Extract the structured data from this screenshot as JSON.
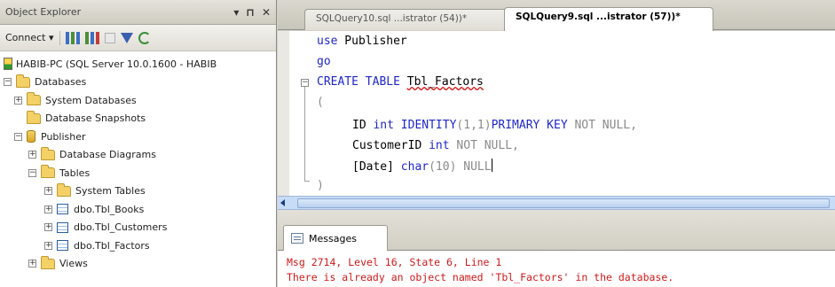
{
  "object_explorer": {
    "title": "Object Explorer",
    "title_controls": [
      "▾",
      "⊓",
      "✕"
    ],
    "connect_label": "Connect ▾",
    "tree": [
      {
        "level": 0,
        "toggle": "",
        "icon": "server-icon",
        "label": "HABIB-PC (SQL Server 10.0.1600 - HABIB"
      },
      {
        "level": 0,
        "toggle": "−",
        "icon": "folder-icon",
        "label": "Databases"
      },
      {
        "level": 1,
        "toggle": "+",
        "icon": "folder-icon",
        "label": "System Databases"
      },
      {
        "level": 1,
        "toggle": "",
        "icon": "folder-icon",
        "label": "Database Snapshots"
      },
      {
        "level": 1,
        "toggle": "−",
        "icon": "database-icon",
        "label": "Publisher"
      },
      {
        "level": 2,
        "toggle": "+",
        "icon": "folder-icon",
        "label": "Database Diagrams"
      },
      {
        "level": 2,
        "toggle": "−",
        "icon": "folder-icon",
        "label": "Tables"
      },
      {
        "level": 3,
        "toggle": "+",
        "icon": "folder-icon",
        "label": "System Tables"
      },
      {
        "level": 3,
        "toggle": "+",
        "icon": "table-icon",
        "label": "dbo.Tbl_Books"
      },
      {
        "level": 3,
        "toggle": "+",
        "icon": "table-icon",
        "label": "dbo.Tbl_Customers"
      },
      {
        "level": 3,
        "toggle": "+",
        "icon": "table-icon",
        "label": "dbo.Tbl_Factors"
      },
      {
        "level": 2,
        "toggle": "+",
        "icon": "folder-icon",
        "label": "Views"
      }
    ]
  },
  "query_tabs": [
    {
      "label": "SQLQuery10.sql ...istrator (54))*",
      "active": false
    },
    {
      "label": "SQLQuery9.sql ...istrator (57))*",
      "active": true
    }
  ],
  "editor": {
    "lines": {
      "l1_kw": "use",
      "l1_rest": " Publisher",
      "l2_kw": "go",
      "l3_kw": "CREATE TABLE",
      "l3_name": "Tbl_Factors",
      "l4": "(",
      "l5_col": "ID",
      "l5_type": "int",
      "l5_ident": "IDENTITY",
      "l5_args": "(1,1)",
      "l5_pk": "PRIMARY KEY",
      "l5_nn": "NOT NULL",
      "l5_comma": ",",
      "l6_col": "CustomerID",
      "l6_type": "int",
      "l6_nn": "NOT NULL",
      "l6_comma": ",",
      "l7_col": "[Date]",
      "l7_type": "char",
      "l7_args": "(10)",
      "l7_null": "NULL",
      "l8": ")"
    }
  },
  "messages": {
    "tab_label": "Messages",
    "error_line1": "Msg 2714, Level 16, State 6, Line 1",
    "error_line2": "There is already an object named 'Tbl_Factors' in the database."
  }
}
